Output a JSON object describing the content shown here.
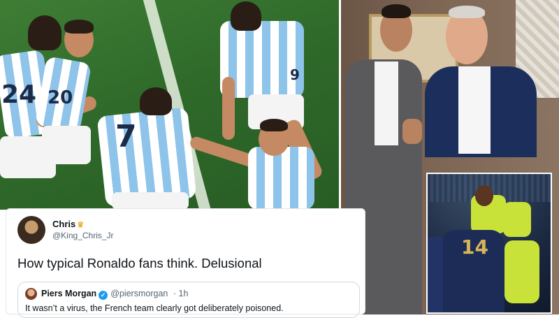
{
  "tweet": {
    "author_name": "Chris",
    "author_emoji": "crown",
    "author_handle": "@King_Chris_Jr",
    "text": "How typical Ronaldo fans think. Delusional",
    "quoted": {
      "author_name": "Piers Morgan",
      "verified_icon": "verified-badge-icon",
      "author_handle": "@piersmorgan",
      "separator": "·",
      "time": "1h",
      "text": "It wasn’t a virus, the French team clearly got deliberately poisoned."
    }
  },
  "photos": {
    "left_jersey_numbers": [
      "7",
      "9",
      "20",
      "24"
    ],
    "inset_jersey_number": "14"
  },
  "colors": {
    "verified_blue": "#1d9bf0",
    "argentina_sky_blue": "#8ec3ea",
    "france_navy": "#1c2c57",
    "pitch_green": "#2f6a2a"
  }
}
